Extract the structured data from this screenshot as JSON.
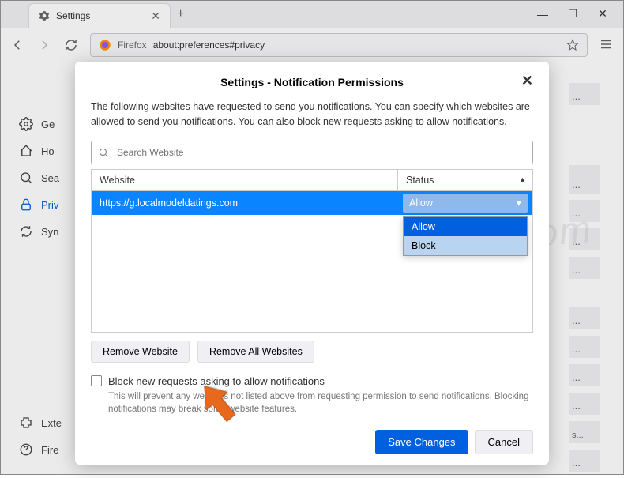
{
  "tab": {
    "title": "Settings"
  },
  "toolbar": {
    "prefix": "Firefox",
    "url": "about:preferences#privacy"
  },
  "sidebar": {
    "items": [
      {
        "icon": "gear",
        "label": "Ge"
      },
      {
        "icon": "home",
        "label": "Ho"
      },
      {
        "icon": "search",
        "label": "Sea"
      },
      {
        "icon": "lock",
        "label": "Priv"
      },
      {
        "icon": "sync",
        "label": "Syn"
      }
    ],
    "bottom": [
      {
        "icon": "puzzle",
        "label": "Exte"
      },
      {
        "icon": "help",
        "label": "Fire"
      }
    ],
    "active_index": 3
  },
  "modal": {
    "title": "Settings - Notification Permissions",
    "description": "The following websites have requested to send you notifications. You can specify which websites are allowed to send you notifications. You can also block new requests asking to allow notifications.",
    "search_placeholder": "Search Website",
    "columns": {
      "website": "Website",
      "status": "Status"
    },
    "rows": [
      {
        "site": "https://g.localmodeldatings.com",
        "status": "Allow"
      }
    ],
    "dropdown_options": [
      "Allow",
      "Block"
    ],
    "remove_website": "Remove Website",
    "remove_all": "Remove All Websites",
    "block_label": "Block new requests asking to allow notifications",
    "block_desc": "This will prevent any websites not listed above from requesting permission to send notifications. Blocking notifications may break some website features.",
    "save": "Save Changes",
    "cancel": "Cancel"
  },
  "content_stub": "..."
}
